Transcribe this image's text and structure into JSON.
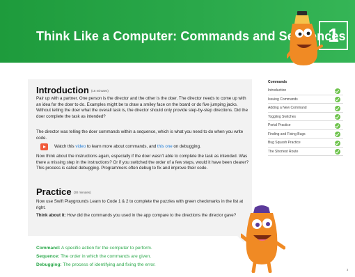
{
  "header": {
    "title": "Think Like a Computer: Commands and Sequences",
    "lesson_number": "1"
  },
  "introduction": {
    "heading": "Introduction",
    "duration": "(15 minutes)",
    "p1": "Pair up with a partner. One person is the director and the other is the doer. The director needs to come up with an idea for the doer to do. Examples might be to draw a smiley face on the board or do five jumping jacks. Without telling the doer what the overall task is, the director should only provide step-by-step directions. Did the doer complete the task as intended?",
    "p2": "The director was telling the doer commands within a sequence, which is what you need to do when you write code.",
    "video_pre": "Watch this ",
    "video_link1": "video",
    "video_mid": " to learn more about commands, and ",
    "video_link2": "this one",
    "video_post": " on debugging.",
    "p3": "Now think about the instructions again, especially if the doer wasn't able to complete the task as intended. Was there a missing step in the instructions? Or if you switched the order of a few steps, would it have been clearer? This process is called debugging. Programmers often debug to fix and improve their code."
  },
  "practice": {
    "heading": "Practice",
    "duration": "(30 minutes)",
    "p1": "Now use Swift Playgrounds Learn to Code 1 & 2 to complete the puzzles with green checkmarks in the list at right.",
    "think_label": "Think about it:",
    "think_text": " How did the commands you used in the app compare to the directions the director gave?"
  },
  "sidebar": {
    "title": "Commands",
    "items": [
      "Introduction",
      "Issuing Commands",
      "Adding a New Command",
      "Toggling Switches",
      "Portal Practice",
      "Finding and Fixing Bugs",
      "Bug Squash Practice",
      "The Shortest Route"
    ]
  },
  "vocabulary": [
    {
      "term": "Command:",
      "definition": " A specific action for the computer to perform."
    },
    {
      "term": "Sequence:",
      "definition": " The order in which the commands are given."
    },
    {
      "term": "Debugging:",
      "definition": " The process of identifying and fixing the error."
    }
  ],
  "page_number": "3",
  "colors": {
    "banner_green": "#2aa84a",
    "check_green": "#6cc24a",
    "link_blue": "#1e7bd6",
    "character_orange": "#f08a24"
  }
}
